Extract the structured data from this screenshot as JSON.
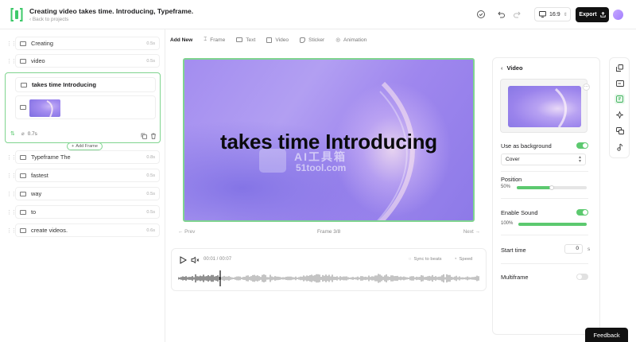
{
  "header": {
    "title": "Creating video takes time. Introducing, Typeframe.",
    "back_link": "Back to projects",
    "aspect_ratio": "16:9",
    "export_label": "Export"
  },
  "sidebar": {
    "frames_before": [
      {
        "label": "Creating",
        "duration": "0.5s"
      },
      {
        "label": "video",
        "duration": "0.5s"
      }
    ],
    "active_frame": {
      "label": "takes time Introducing",
      "duration": "0.7s"
    },
    "add_frame_label": "Add Frame",
    "frames_after": [
      {
        "label": "Typeframe The",
        "duration": "0.8s"
      },
      {
        "label": "fastest",
        "duration": "0.5s"
      },
      {
        "label": "way",
        "duration": "0.5s"
      },
      {
        "label": "to",
        "duration": "0.5s"
      },
      {
        "label": "create videos.",
        "duration": "0.6s"
      }
    ]
  },
  "toolbar": {
    "add_new": "Add New",
    "items": [
      "Frame",
      "Text",
      "Video",
      "Sticker",
      "Animation"
    ]
  },
  "canvas": {
    "text": "takes time Introducing",
    "watermark_cn": "AI工具箱",
    "watermark_url": "51tool.com"
  },
  "nav": {
    "prev": "Prev",
    "counter": "Frame 3/8",
    "next": "Next"
  },
  "audio": {
    "time": "00:01 / 00:07",
    "sync_label": "Sync to beats",
    "speed_label": "Speed",
    "playhead_fraction": 0.14
  },
  "right_panel": {
    "heading": "Video",
    "use_as_background_label": "Use as background",
    "use_as_background": true,
    "fit_select": "Cover",
    "position_label": "Position",
    "position_pct": "50%",
    "position_value": 50,
    "enable_sound_label": "Enable Sound",
    "enable_sound": true,
    "volume_pct": "100%",
    "volume_value": 100,
    "start_time_label": "Start time",
    "start_time_value": "0",
    "start_time_unit": "s",
    "multiframe_label": "Multiframe",
    "multiframe": false
  },
  "feedback_label": "Feedback",
  "colors": {
    "accent_green": "#5cc96f",
    "frame_border": "#7fd48f",
    "export_bg": "#111111"
  }
}
